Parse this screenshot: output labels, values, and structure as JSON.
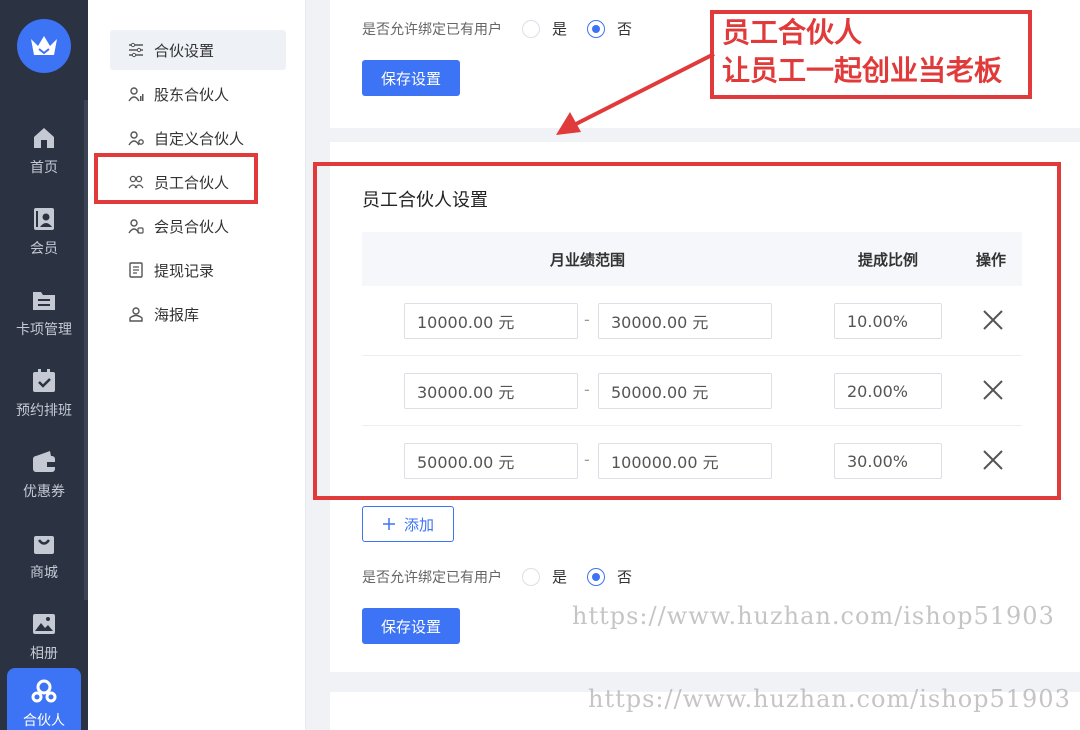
{
  "rail": {
    "items": [
      {
        "label": "首页",
        "icon": "home-icon"
      },
      {
        "label": "会员",
        "icon": "member-card-icon"
      },
      {
        "label": "卡项管理",
        "icon": "folder-list-icon"
      },
      {
        "label": "预约排班",
        "icon": "calendar-check-icon"
      },
      {
        "label": "优惠券",
        "icon": "wallet-icon"
      },
      {
        "label": "商城",
        "icon": "shopping-bag-icon"
      },
      {
        "label": "相册",
        "icon": "image-icon"
      },
      {
        "label": "合伙人",
        "icon": "partner-icon"
      }
    ]
  },
  "submenu": {
    "items": [
      {
        "label": "合伙设置",
        "icon": "settings-sliders-icon"
      },
      {
        "label": "股东合伙人",
        "icon": "shareholder-icon"
      },
      {
        "label": "自定义合伙人",
        "icon": "custom-partner-icon"
      },
      {
        "label": "员工合伙人",
        "icon": "employee-group-icon"
      },
      {
        "label": "会员合伙人",
        "icon": "member-partner-icon"
      },
      {
        "label": "提现记录",
        "icon": "document-icon"
      },
      {
        "label": "海报库",
        "icon": "poster-user-icon"
      }
    ]
  },
  "top_card": {
    "bind_label": "是否允许绑定已有用户",
    "yes": "是",
    "no": "否",
    "selected": "否",
    "save": "保存设置"
  },
  "annotation": {
    "line1": "员工合伙人",
    "line2": "让员工一起创业当老板",
    "color": "#e03a3a"
  },
  "section": {
    "title": "员工合伙人设置",
    "headers": {
      "range": "月业绩范围",
      "ratio": "提成比例",
      "action": "操作"
    },
    "rows": [
      {
        "from": "10000.00 元",
        "to": "30000.00 元",
        "ratio": "10.00%"
      },
      {
        "from": "30000.00 元",
        "to": "50000.00 元",
        "ratio": "20.00%"
      },
      {
        "from": "50000.00 元",
        "to": "100000.00 元",
        "ratio": "30.00%"
      }
    ],
    "dash": "-",
    "add": "添加",
    "bind_label": "是否允许绑定已有用户",
    "yes": "是",
    "no": "否",
    "selected": "否",
    "save": "保存设置"
  },
  "watermark": {
    "text1": "https://www.huzhan.com/ishop51903",
    "text2": "https://www.huzhan.com/ishop51903"
  },
  "colors": {
    "accent": "#3d73f5",
    "rail": "#2b3242",
    "annotation": "#e03a3a"
  }
}
